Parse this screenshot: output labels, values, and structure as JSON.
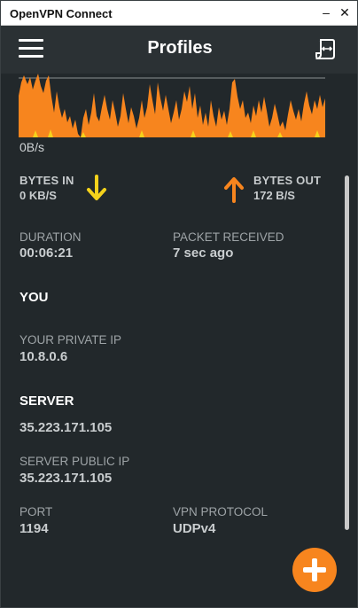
{
  "window": {
    "title": "OpenVPN Connect",
    "minimize": "–",
    "close": "✕"
  },
  "header": {
    "title": "Profiles",
    "menu_icon": "hamburger-icon",
    "import_icon": "import-profile-icon"
  },
  "graph": {
    "label": "0B/s",
    "colors": {
      "fill": "#f7851e",
      "accent": "#f5d21b",
      "line": "#8a8f92"
    }
  },
  "stats": {
    "bytes_in": {
      "label": "BYTES IN",
      "value": "0 KB/S",
      "color": "#f5d21b"
    },
    "bytes_out": {
      "label": "BYTES OUT",
      "value": "172 B/S",
      "color": "#f7851e"
    }
  },
  "connection": {
    "duration": {
      "label": "DURATION",
      "value": "00:06:21"
    },
    "packet_received": {
      "label": "PACKET RECEIVED",
      "value": "7 sec ago"
    }
  },
  "you": {
    "heading": "YOU",
    "private_ip": {
      "label": "YOUR PRIVATE IP",
      "value": "10.8.0.6"
    }
  },
  "server": {
    "heading": "SERVER",
    "host": "35.223.171.105",
    "public_ip": {
      "label": "SERVER PUBLIC IP",
      "value": "35.223.171.105"
    },
    "port": {
      "label": "PORT",
      "value": "1194"
    },
    "protocol": {
      "label": "VPN PROTOCOL",
      "value": "UDPv4"
    }
  },
  "fab": {
    "icon": "add-icon",
    "color": "#f7851e"
  }
}
